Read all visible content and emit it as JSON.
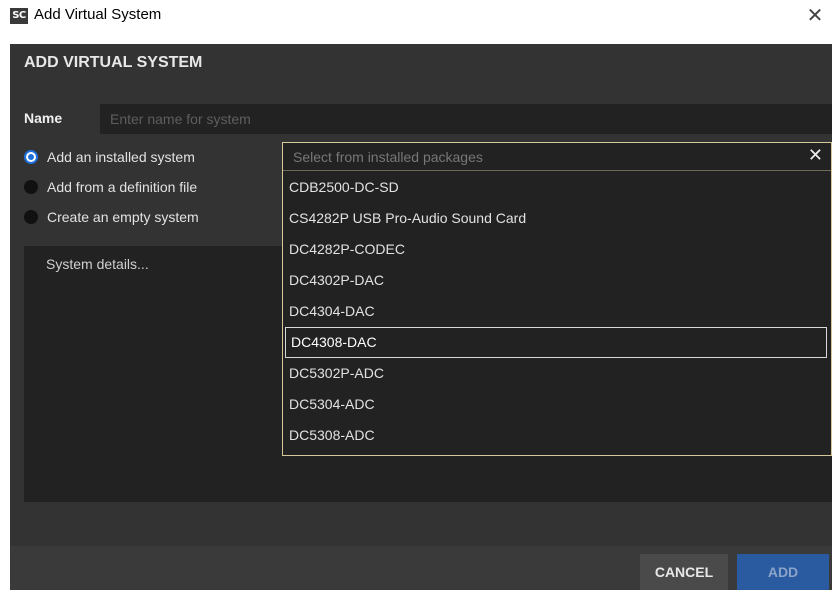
{
  "window": {
    "app_icon": "SC",
    "title": "Add Virtual System",
    "close_glyph": "✕"
  },
  "dialog": {
    "heading": "ADD VIRTUAL SYSTEM",
    "name_label": "Name",
    "name_placeholder": "Enter name for system",
    "name_value": "",
    "options": [
      {
        "label": "Add an installed system",
        "selected": true
      },
      {
        "label": "Add from a definition file",
        "selected": false
      },
      {
        "label": "Create an empty system",
        "selected": false
      }
    ],
    "details_placeholder": "System details..."
  },
  "dropdown": {
    "placeholder": "Select from installed packages",
    "clear_glyph": "✕",
    "items": [
      "CDB2500-DC-SD",
      "CS4282P USB Pro-Audio Sound Card",
      "DC4282P-CODEC",
      "DC4302P-DAC",
      "DC4304-DAC",
      "DC4308-DAC",
      "DC5302P-ADC",
      "DC5304-ADC",
      "DC5308-ADC"
    ],
    "highlighted_item": "DC4308-DAC"
  },
  "footer": {
    "cancel_label": "CANCEL",
    "add_label": "ADD"
  },
  "colors": {
    "dialog_bg": "#333333",
    "field_bg": "#222222",
    "dropdown_border": "#d5c99b",
    "radio_accent": "#1e6fdc",
    "add_button": "#2a5aa0"
  }
}
